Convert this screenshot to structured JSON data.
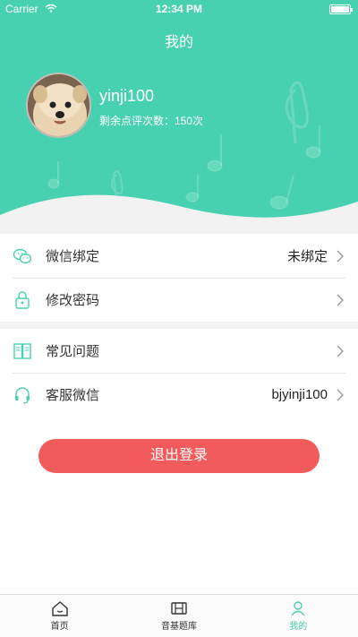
{
  "status_bar": {
    "carrier": "Carrier",
    "time": "12:34 PM"
  },
  "page": {
    "title": "我的"
  },
  "profile": {
    "username": "yinji100",
    "remaining": "剩余点评次数：150次"
  },
  "menu_group_1": [
    {
      "label": "微信绑定",
      "value": "未绑定",
      "icon": "wechat-icon"
    },
    {
      "label": "修改密码",
      "value": "",
      "icon": "lock-icon"
    }
  ],
  "menu_group_2": [
    {
      "label": "常见问题",
      "value": "",
      "icon": "book-icon"
    },
    {
      "label": "客服微信",
      "value": "bjyinji100",
      "icon": "headset-icon"
    }
  ],
  "logout_label": "退出登录",
  "tabs": [
    {
      "label": "首页",
      "icon": "home-icon"
    },
    {
      "label": "音基题库",
      "icon": "question-bank-icon"
    },
    {
      "label": "我的",
      "icon": "profile-icon"
    }
  ],
  "colors": {
    "accent": "#48d1b0",
    "logout": "#f25b5b"
  }
}
